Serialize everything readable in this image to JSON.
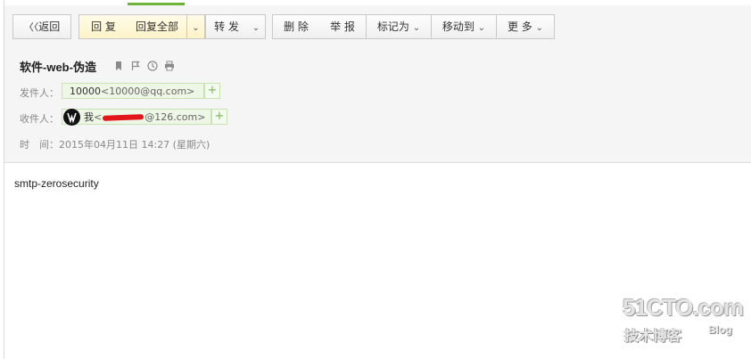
{
  "toolbar": {
    "back_label": "返回",
    "reply_label": "回 复",
    "reply_all_label": "回复全部",
    "forward_label": "转 发",
    "delete_label": "删 除",
    "report_label": "举 报",
    "mark_as_label": "标记为",
    "move_to_label": "移动到",
    "more_label": "更 多"
  },
  "mail": {
    "subject": "软件-web-伪造",
    "from_label": "发件人：",
    "from_name": "10000",
    "from_addr": "<10000@qq.com>",
    "to_label": "收件人：",
    "to_name": "我",
    "to_addr_prefix": "<",
    "to_addr_suffix": "@126.com>",
    "time_label": "时　间：",
    "time_value": "2015年04月11日 14:27 (星期六)",
    "body": "smtp-zerosecurity"
  },
  "watermark": {
    "main": "51CTO.com",
    "sub": "技术博客",
    "blog": "Blog"
  },
  "icons": [
    "back-chevrons-icon",
    "chevron-down-icon",
    "bookmark-icon",
    "flag-icon",
    "clock-icon",
    "print-icon",
    "plus-icon",
    "avatar"
  ],
  "colors": {
    "accent": "#6fb23a",
    "chip_bg": "#eef6e6",
    "redaction": "#e0161b"
  }
}
